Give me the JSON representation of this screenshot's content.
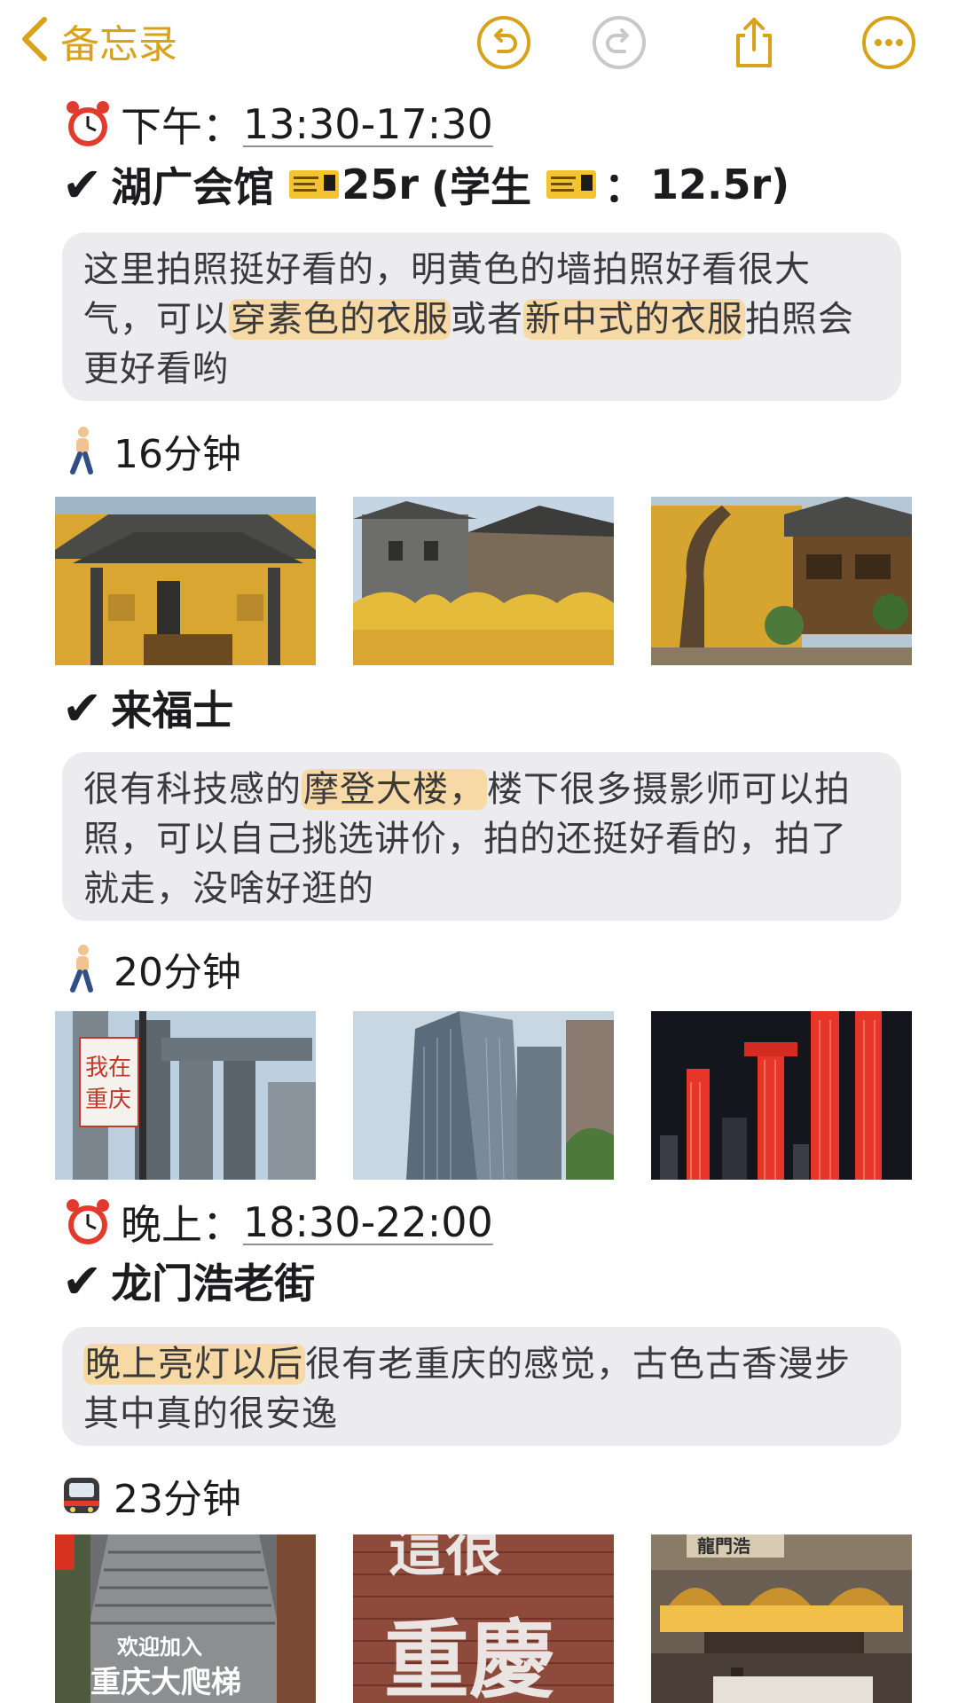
{
  "navbar": {
    "back_label": "备忘录"
  },
  "afternoon": {
    "label": "下午：",
    "time": "13:30-17:30"
  },
  "spot1": {
    "name": "湖广会馆",
    "price": "25r",
    "student_open": "(学生",
    "student_colon": "：",
    "student_price": "12.5r)",
    "note": {
      "p1": "这里拍照挺好看的，明黄色的墙拍照好看很大气，可以",
      "h1": "穿素色的衣服",
      "p2": "或者",
      "h2": "新中式的衣服",
      "p3": "拍照会更好看哟"
    }
  },
  "walk1": {
    "text": "16分钟"
  },
  "spot2": {
    "name": "来福士",
    "note": {
      "p1": "很有科技感的",
      "h1": "摩登大楼，",
      "p2": "楼下很多摄影师可以拍照，可以自己挑选讲价，拍的还挺好看的，拍了就走，没啥好逛的"
    }
  },
  "walk2": {
    "text": "20分钟"
  },
  "photos2": {
    "sign_text": "我在重庆"
  },
  "evening": {
    "label": "晚上：",
    "time": "18:30-22:00"
  },
  "spot3": {
    "name": "龙门浩老街",
    "note": {
      "h1": "晚上亮灯以后",
      "p1": "很有老重庆的感觉，古色古香漫步其中真的很安逸"
    }
  },
  "metro": {
    "text": "23分钟"
  },
  "photos3": {
    "stair_text_1": "欢迎加入",
    "stair_text_2": "重庆大爬梯",
    "wall_text": "重慶",
    "gate_sign": "龍門浩"
  },
  "colors": {
    "accent": "#d9a21b",
    "highlight": "#f7d9a6",
    "card": "#ececee"
  }
}
